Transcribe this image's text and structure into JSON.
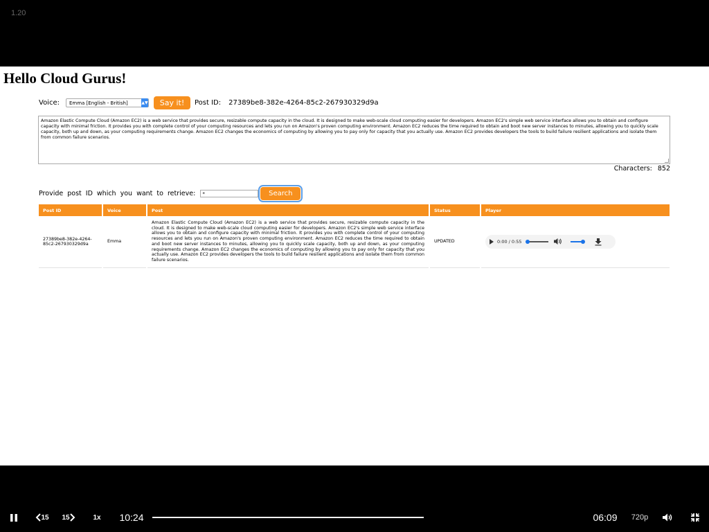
{
  "player": {
    "speed_overlay": "1.20",
    "current_time": "10:24",
    "remaining_time": "06:09",
    "quality": "720p",
    "rate_label": "1x",
    "back_label": "15",
    "fwd_label": "15",
    "progress_fraction": 0.6
  },
  "page": {
    "title": "Hello Cloud Gurus!",
    "voice_label": "Voice:",
    "voice_selected": "Emma [English - British]",
    "say_button": "Say it!",
    "postid_label": "Post  ID:",
    "postid_value": "27389be8-382e-4264-85c2-267930329d9a",
    "textarea_text": "Amazon Elastic Compute Cloud (Amazon EC2) is a web service that provides secure, resizable compute capacity in the cloud. It is designed to make web-scale cloud computing easier for developers. Amazon EC2's simple web service interface allows you to obtain and configure capacity with minimal friction. It provides you with complete control of your computing resources and lets you run on Amazon's proven computing environment. Amazon EC2 reduces the time required to obtain and boot new server instances to minutes, allowing you to quickly scale capacity, both up and down, as your computing requirements change. Amazon EC2 changes the economics of computing by allowing you to pay only for capacity that you actually use. Amazon EC2 provides developers the tools to build failure resilient applications and isolate them from common failure scenarios.",
    "characters_label": "Characters:",
    "characters_value": "852",
    "retrieve_label": "Provide post ID which you want to retrieve:",
    "retrieve_value": "*",
    "search_button": "Search",
    "table": {
      "headers": [
        "Post  ID",
        "Voice",
        "Post",
        "Status",
        "Player"
      ],
      "row": {
        "post_id": "27389be8-382e-4264-85c2-267930329d9a",
        "voice": "Emma",
        "post": "Amazon Elastic Compute Cloud (Amazon EC2) is a web service that provides secure, resizable compute capacity in the cloud. It is designed to make web-scale cloud computing easier for developers. Amazon EC2's simple web service interface allows you to obtain and configure capacity with minimal friction. It provides you with complete control of your computing resources and lets you run on Amazon's proven computing environment. Amazon EC2 reduces the time required to obtain and boot new server instances to minutes, allowing you to quickly scale capacity, both up and down, as your computing requirements change. Amazon EC2 changes the economics of computing by allowing you to pay only for capacity that you actually use. Amazon EC2 provides developers the tools to build failure resilient applications and isolate them from common failure scenarios.",
        "status": "UPDATED",
        "audio_time": "0:00 / 0:55"
      }
    }
  },
  "colors": {
    "accent": "#f7901e",
    "focus": "#5b9ee8"
  },
  "icons": [
    "pause-icon",
    "rewind-15-icon",
    "forward-15-icon",
    "volume-icon",
    "exit-fullscreen-icon",
    "play-icon",
    "download-icon"
  ]
}
